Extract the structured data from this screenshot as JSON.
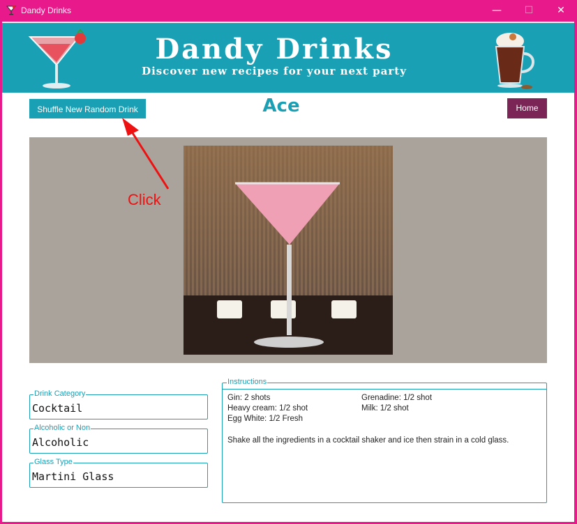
{
  "window": {
    "title": "Dandy Drinks",
    "min_glyph": "—",
    "max_glyph": "☐",
    "close_glyph": "✕",
    "accent": "#e8198a"
  },
  "banner": {
    "title": "Dandy Drinks",
    "subtitle": "Discover new recipes for your next party",
    "bg": "#19a0b5"
  },
  "toolbar": {
    "shuffle_label": "Shuffle New Random Drink",
    "home_label": "Home"
  },
  "drink": {
    "name": "Ace",
    "category_legend": "Drink Category",
    "category": "Cocktail",
    "alcoholic_legend": "Alcoholic or Non",
    "alcoholic": "Alcoholic",
    "glass_legend": "Glass Type",
    "glass": "Martini Glass"
  },
  "instructions": {
    "legend": "Instructions",
    "ingredients": [
      "Gin: 2 shots",
      "Heavy cream: 1/2 shot",
      "Egg White: 1/2 Fresh",
      "Grenadine: 1/2 shot",
      "Milk: 1/2 shot"
    ],
    "text": "Shake all the ingredients in a cocktail shaker and ice then strain in a cold glass."
  },
  "annotation": {
    "label": "Click"
  }
}
